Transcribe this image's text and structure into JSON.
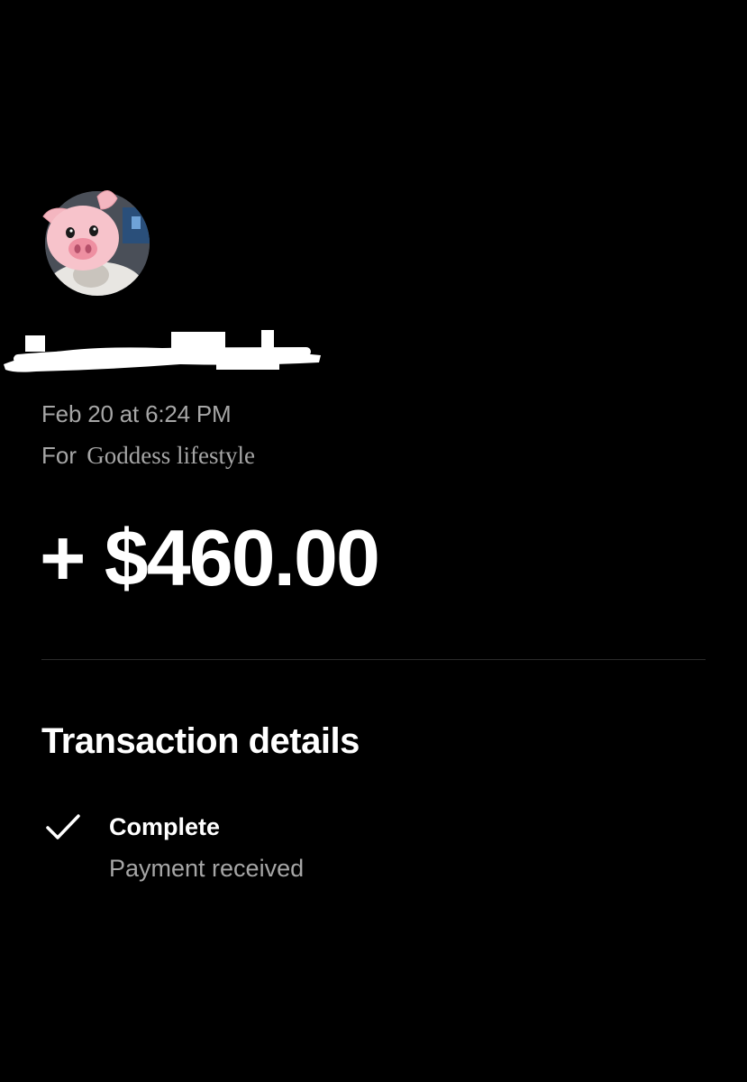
{
  "profile": {
    "avatar_icon": "pig-face-avatar-icon",
    "name_redacted": true
  },
  "transaction": {
    "date": "Feb 20 at 6:24 PM",
    "for_prefix": "For",
    "note": "Goddess lifestyle",
    "amount": "+ $460.00"
  },
  "details": {
    "title": "Transaction details",
    "status_icon": "checkmark-icon",
    "status": "Complete",
    "status_sub": "Payment received"
  },
  "colors": {
    "background": "#000000",
    "primary_text": "#ffffff",
    "secondary_text": "#a6a6a6",
    "divider": "#2b2b2b"
  }
}
